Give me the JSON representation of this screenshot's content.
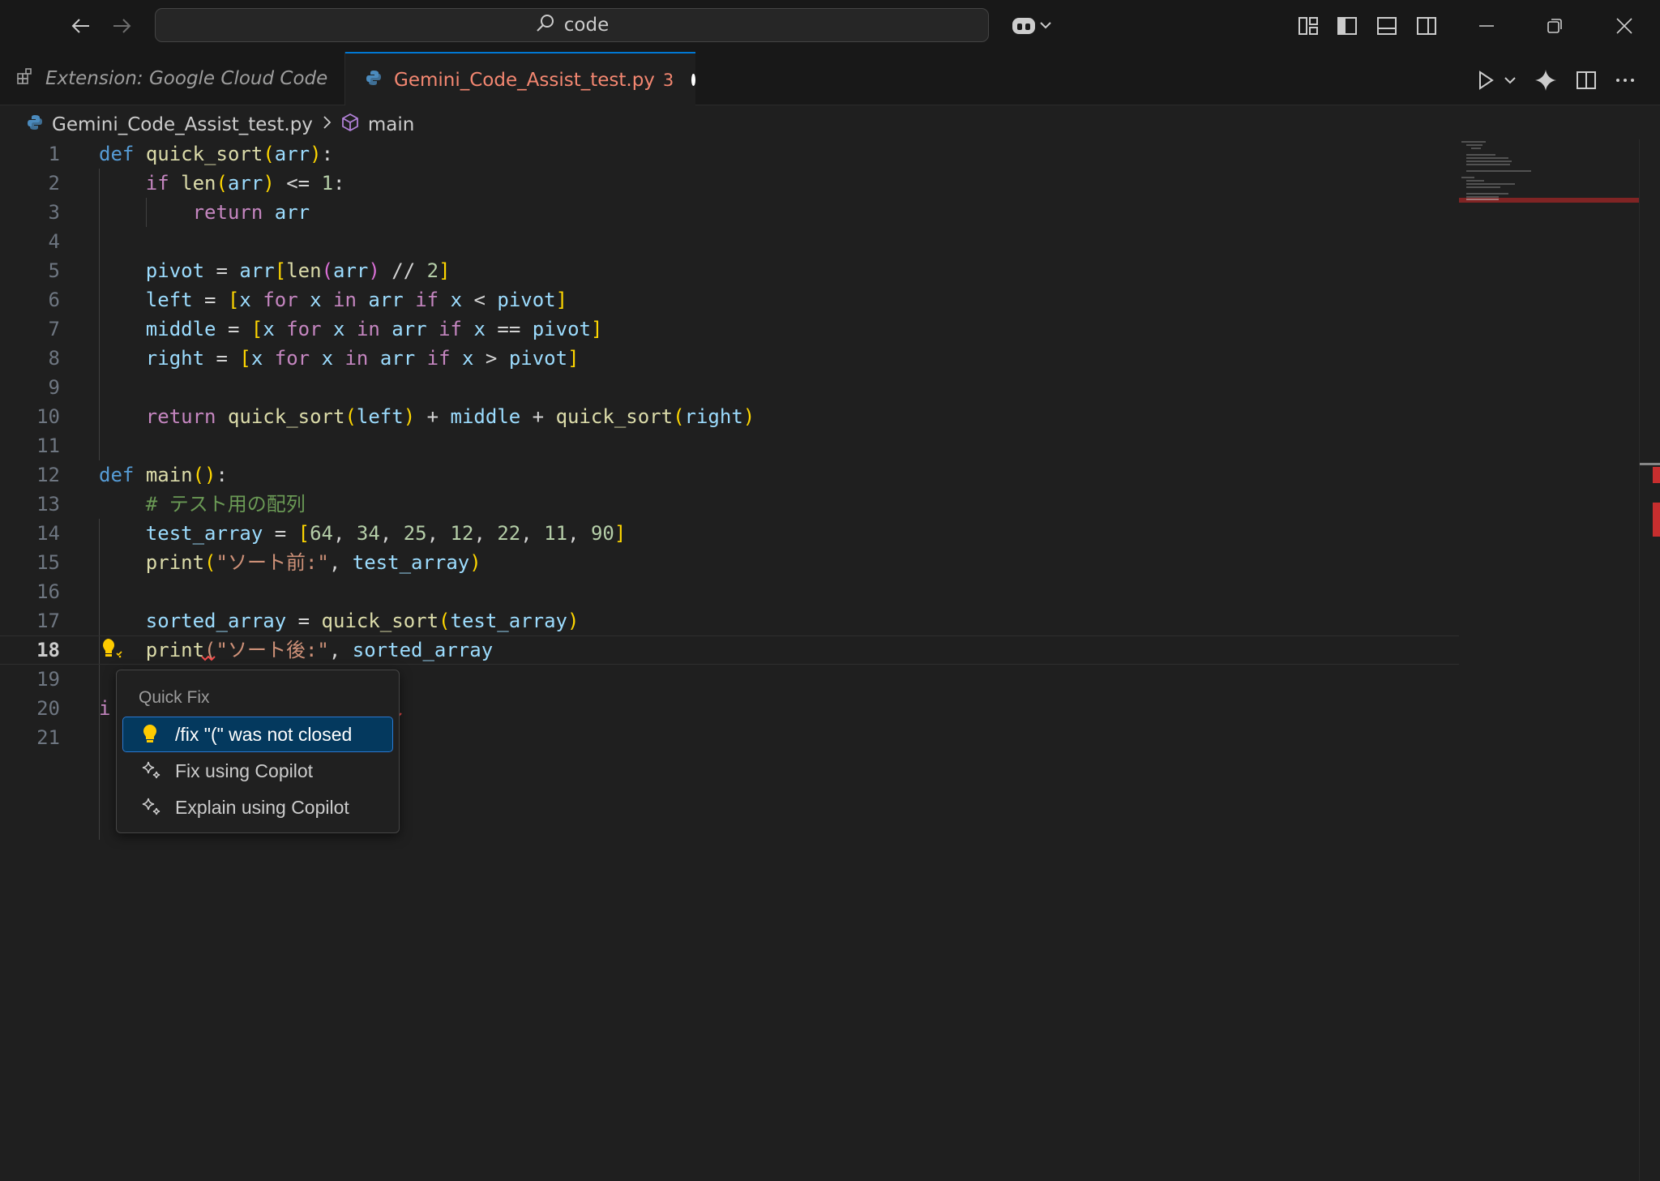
{
  "titlebar": {
    "search_text": "code"
  },
  "tabs": [
    {
      "label": "Extension: Google Cloud Code"
    },
    {
      "label": "Gemini_Code_Assist_test.py",
      "problem_count": "3"
    }
  ],
  "breadcrumb": {
    "file": "Gemini_Code_Assist_test.py",
    "symbol": "main"
  },
  "editor": {
    "active_line": 18,
    "line_numbers": [
      "1",
      "2",
      "3",
      "4",
      "5",
      "6",
      "7",
      "8",
      "9",
      "10",
      "11",
      "12",
      "13",
      "14",
      "15",
      "16",
      "17",
      "18",
      "19",
      "20",
      "21"
    ],
    "partial_line_20_visible": "i",
    "code_lines": [
      "def quick_sort(arr):",
      "    if len(arr) <= 1:",
      "        return arr",
      "",
      "    pivot = arr[len(arr) // 2]",
      "    left = [x for x in arr if x < pivot]",
      "    middle = [x for x in arr if x == pivot]",
      "    right = [x for x in arr if x > pivot]",
      "",
      "    return quick_sort(left) + middle + quick_sort(right)",
      "",
      "def main():",
      "    # テスト用の配列",
      "    test_array = [64, 34, 25, 12, 22, 11, 90]",
      "    print(\"ソート前:\", test_array)",
      "",
      "    sorted_array = quick_sort(test_array)",
      "    print(\"ソート後:\", sorted_array"
    ]
  },
  "quick_fix": {
    "title": "Quick Fix",
    "items": [
      {
        "label": "/fix \"(\" was not closed",
        "icon": "lightbulb-icon",
        "selected": true
      },
      {
        "label": "Fix using Copilot",
        "icon": "sparkle-icon",
        "selected": false
      },
      {
        "label": "Explain using Copilot",
        "icon": "sparkle-icon",
        "selected": false
      }
    ]
  },
  "colors": {
    "editor_bg": "#1f1f1f",
    "accent": "#0078d4",
    "error": "#f14c4c",
    "modified_tab_text": "#f48771",
    "keyword": "#569cd6",
    "control": "#c586c0",
    "function": "#dcdcaa",
    "variable": "#9cdcfe",
    "number": "#b5cea8",
    "string": "#ce9178",
    "comment": "#6a9955"
  }
}
